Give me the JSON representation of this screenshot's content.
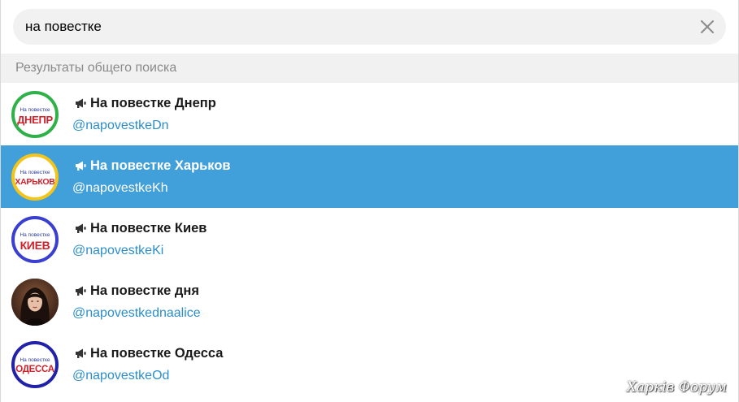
{
  "search": {
    "value": "на повестке"
  },
  "section": {
    "title": "Результаты общего поиска"
  },
  "results": [
    {
      "title": "На повестке Днепр",
      "handle": "@napovestkeDn",
      "avatar_small": "На повестке",
      "avatar_big": "ДНЕПР",
      "ring_color": "#2fb14a",
      "selected": false
    },
    {
      "title": "На повестке Харьков",
      "handle": "@napovestkeKh",
      "avatar_small": "На повестке",
      "avatar_big": "ХАРЬКОВ",
      "ring_color": "#f3c51c",
      "selected": true
    },
    {
      "title": "На повестке Киев",
      "handle": "@napovestkeKi",
      "avatar_small": "На повестке",
      "avatar_big": "КИЕВ",
      "ring_color": "#3b3fd0",
      "selected": false
    },
    {
      "title": "На повестке дня",
      "handle": "@napovestkednaalice",
      "avatar_small": "",
      "avatar_big": "",
      "ring_color": "#3a2a22",
      "selected": false
    },
    {
      "title": "На повестке Одесса",
      "handle": "@napovestkeOd",
      "avatar_small": "На повестке",
      "avatar_big": "ОДЕССА",
      "ring_color": "#2222a8",
      "selected": false
    }
  ],
  "watermark": "Харків Форум",
  "colors": {
    "selected_row": "#419fd9",
    "link": "#2b8ecb"
  },
  "icons": {
    "clear": "close-icon",
    "channel": "megaphone-icon"
  }
}
